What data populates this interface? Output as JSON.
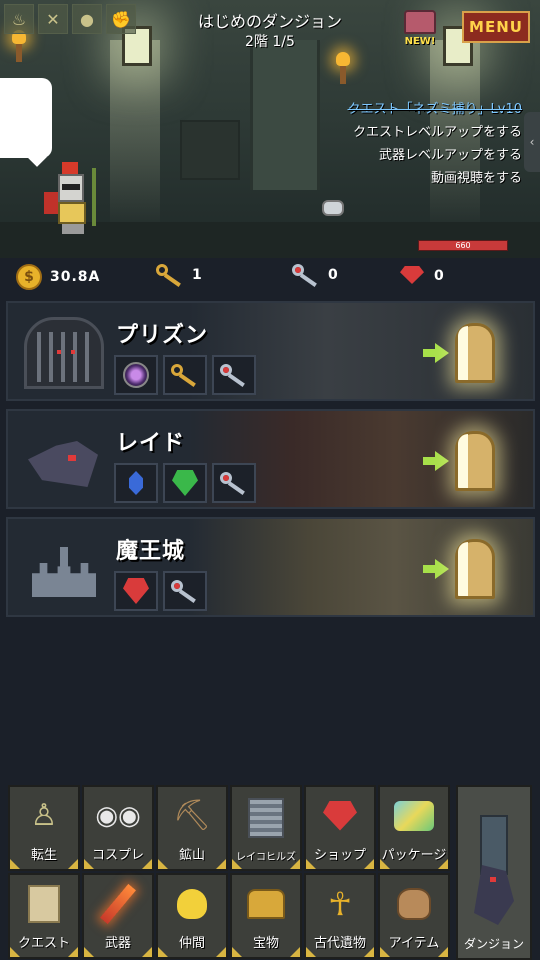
{
  "header": {
    "title": "はじめのダンジョン",
    "subtitle": "2階 1/5",
    "new_badge": "NEW!",
    "menu_label": "MENU"
  },
  "top_icons": [
    "torch-icon",
    "cross-icon",
    "coins-icon",
    "fist-icon"
  ],
  "quests": {
    "items": [
      {
        "label": "クエスト「ネズミ捕り」Lv10",
        "done": true
      },
      {
        "label": "クエストレベルアップをする",
        "done": false
      },
      {
        "label": "武器レベルアップをする",
        "done": false
      },
      {
        "label": "動画視聴をする",
        "done": false
      }
    ]
  },
  "enemy": {
    "hp": "660"
  },
  "currency": {
    "gold": "30.8A",
    "gold_key": "1",
    "silver_key": "0",
    "gem": "0"
  },
  "dungeons": [
    {
      "name": "プリズン",
      "reqs": [
        "orb-icon",
        "gold-key-icon",
        "silver-key-icon"
      ]
    },
    {
      "name": "レイド",
      "reqs": [
        "sapphire-icon",
        "emerald-chest-icon",
        "silver-key-icon"
      ]
    },
    {
      "name": "魔王城",
      "reqs": [
        "ruby-icon",
        "silver-key-icon"
      ]
    }
  ],
  "bottom_menu": {
    "row1": [
      "転生",
      "コスプレ",
      "鉱山",
      "レイコヒルズ",
      "ショップ",
      "パッケージ"
    ],
    "row2": [
      "クエスト",
      "武器",
      "仲間",
      "宝物",
      "古代遺物",
      "アイテム"
    ],
    "dungeon": "ダンジョン"
  },
  "colors": {
    "accent_gold": "#d8b542",
    "menu_red": "#8c2b1f",
    "enter_arrow": "#a7e04a"
  }
}
